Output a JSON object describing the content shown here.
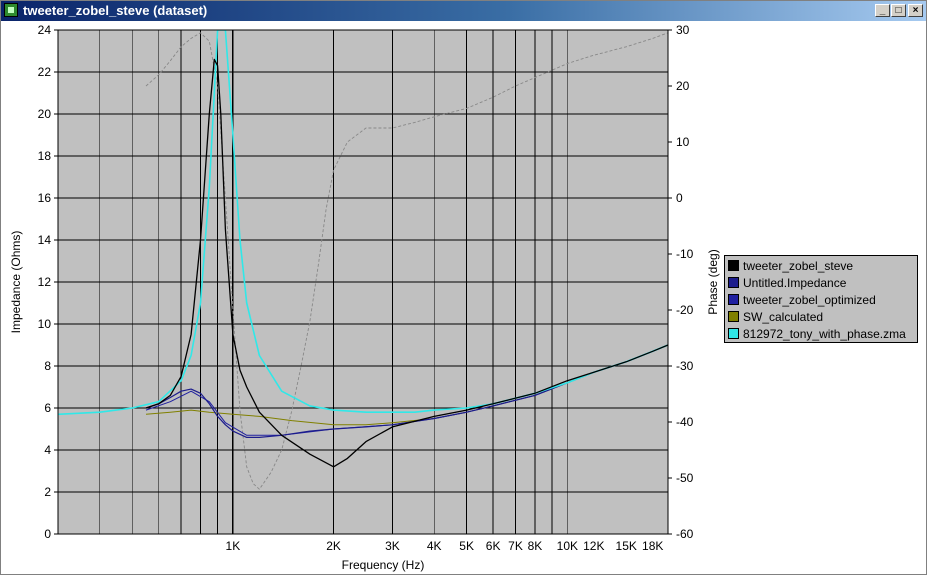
{
  "window": {
    "title": "tweeter_zobel_steve (dataset)"
  },
  "chart_data": {
    "type": "line",
    "xlabel": "Frequency (Hz)",
    "ylabel": "Impedance (Ohms)",
    "y2label": "Phase (deg)",
    "xscale": "log",
    "xlim": [
      300,
      20000
    ],
    "ylim": [
      0,
      24
    ],
    "y2lim": [
      -60,
      30
    ],
    "grid": true,
    "legend_position": "right",
    "x_ticks": [
      {
        "value": 1000,
        "label": "1K"
      },
      {
        "value": 2000,
        "label": "2K"
      },
      {
        "value": 3000,
        "label": "3K"
      },
      {
        "value": 4000,
        "label": "4K"
      },
      {
        "value": 5000,
        "label": "5K"
      },
      {
        "value": 6000,
        "label": "6K"
      },
      {
        "value": 7000,
        "label": "7K"
      },
      {
        "value": 8000,
        "label": "8K"
      },
      {
        "value": 10000,
        "label": "10K"
      },
      {
        "value": 12000,
        "label": "12K"
      },
      {
        "value": 15000,
        "label": "15K"
      },
      {
        "value": 18000,
        "label": "18K"
      }
    ],
    "y_ticks": [
      "0",
      "2",
      "4",
      "6",
      "8",
      "10",
      "12",
      "14",
      "16",
      "18",
      "20",
      "22",
      "24"
    ],
    "y2_ticks": [
      "-60",
      "-50",
      "-40",
      "-30",
      "-20",
      "-10",
      "0",
      "10",
      "20",
      "30"
    ],
    "series": [
      {
        "name": "tweeter_zobel_steve",
        "color": "#000000",
        "width": 1.3,
        "axis": "left",
        "x": [
          550,
          600,
          650,
          700,
          750,
          800,
          850,
          880,
          900,
          920,
          950,
          1000,
          1050,
          1100,
          1200,
          1400,
          1700,
          2000,
          2200,
          2500,
          3000,
          4000,
          5000,
          6000,
          8000,
          10000,
          12000,
          15000,
          18000,
          20000
        ],
        "y": [
          6.0,
          6.2,
          6.6,
          7.5,
          9.5,
          14.0,
          20.0,
          22.6,
          22.3,
          20.0,
          14.5,
          9.5,
          7.8,
          7.0,
          5.8,
          4.7,
          3.8,
          3.2,
          3.6,
          4.4,
          5.1,
          5.6,
          5.9,
          6.2,
          6.7,
          7.3,
          7.7,
          8.2,
          8.7,
          9.0
        ]
      },
      {
        "name": "Untitled.Impedance",
        "color": "#1c1c8c",
        "width": 1.2,
        "axis": "left",
        "x": [
          550,
          600,
          650,
          700,
          750,
          800,
          850,
          900,
          950,
          1000,
          1100,
          1200,
          1400,
          1700,
          2000,
          2500,
          3000,
          4000,
          5000,
          6000,
          8000,
          10000,
          12000,
          15000,
          18000,
          20000
        ],
        "y": [
          6.0,
          6.2,
          6.5,
          6.8,
          6.9,
          6.7,
          6.2,
          5.6,
          5.2,
          4.9,
          4.6,
          4.6,
          4.7,
          4.9,
          5.0,
          5.1,
          5.2,
          5.5,
          5.8,
          6.1,
          6.6,
          7.2,
          7.7,
          8.2,
          8.7,
          9.0
        ]
      },
      {
        "name": "tweeter_zobel_optimized",
        "color": "#2020a0",
        "width": 1.0,
        "axis": "left",
        "x": [
          550,
          650,
          750,
          850,
          950,
          1100,
          1400,
          2000,
          3000,
          4000,
          5000,
          6000,
          8000,
          10000,
          12000,
          15000,
          18000,
          20000
        ],
        "y": [
          5.9,
          6.3,
          6.8,
          6.3,
          5.3,
          4.7,
          4.7,
          5.0,
          5.2,
          5.5,
          5.8,
          6.1,
          6.6,
          7.2,
          7.7,
          8.2,
          8.7,
          9.0
        ]
      },
      {
        "name": "SW_calculated",
        "color": "#808000",
        "width": 1.0,
        "axis": "left",
        "x": [
          550,
          650,
          750,
          850,
          1000,
          1200,
          1500,
          2000,
          2500,
          3000,
          4000,
          5000,
          6000,
          8000,
          10000,
          12000,
          15000,
          18000,
          20000
        ],
        "y": [
          5.7,
          5.8,
          5.9,
          5.8,
          5.7,
          5.6,
          5.4,
          5.2,
          5.2,
          5.3,
          5.5,
          5.8,
          6.1,
          6.6,
          7.2,
          7.7,
          8.2,
          8.7,
          9.0
        ]
      },
      {
        "name": "812972_tony_with_phase.zma",
        "color": "#30e8e8",
        "width": 1.6,
        "axis": "left",
        "x": [
          300,
          400,
          500,
          600,
          700,
          750,
          800,
          850,
          880,
          900,
          920,
          950,
          1000,
          1050,
          1100,
          1200,
          1400,
          1700,
          2000,
          2500,
          3000,
          3500,
          4000,
          5000,
          6000,
          8000,
          10000,
          12000,
          15000,
          18000,
          20000
        ],
        "y": [
          5.7,
          5.8,
          6.0,
          6.3,
          7.3,
          8.5,
          11.0,
          16.5,
          21.0,
          24.0,
          24.0,
          24.0,
          19.0,
          14.0,
          11.0,
          8.5,
          6.8,
          6.1,
          5.9,
          5.8,
          5.8,
          5.8,
          5.9,
          6.0,
          6.2,
          6.7,
          7.2,
          7.7,
          8.2,
          8.7,
          9.0
        ]
      },
      {
        "name": "",
        "color": "#888888",
        "width": 0.9,
        "dash": "3,2",
        "axis": "right",
        "x": [
          550,
          600,
          650,
          700,
          750,
          800,
          850,
          900,
          950,
          1000,
          1050,
          1100,
          1150,
          1200,
          1300,
          1400,
          1500,
          1600,
          1700,
          1800,
          1900,
          2000,
          2200,
          2500,
          3000,
          3500,
          4000,
          5000,
          6000,
          7000,
          8000,
          10000,
          12000,
          15000,
          18000,
          20000
        ],
        "y": [
          20.0,
          22.0,
          24.5,
          27.0,
          28.5,
          29.5,
          28.0,
          20.0,
          0,
          -20.0,
          -38.0,
          -48.0,
          -51.0,
          -52.0,
          -49.0,
          -45.0,
          -38.0,
          -30.0,
          -22.0,
          -12.0,
          -2.0,
          5.0,
          10.0,
          12.5,
          12.5,
          13.5,
          14.5,
          16.0,
          18.0,
          20.0,
          21.5,
          24.0,
          25.5,
          27.0,
          28.5,
          29.5
        ]
      }
    ]
  }
}
